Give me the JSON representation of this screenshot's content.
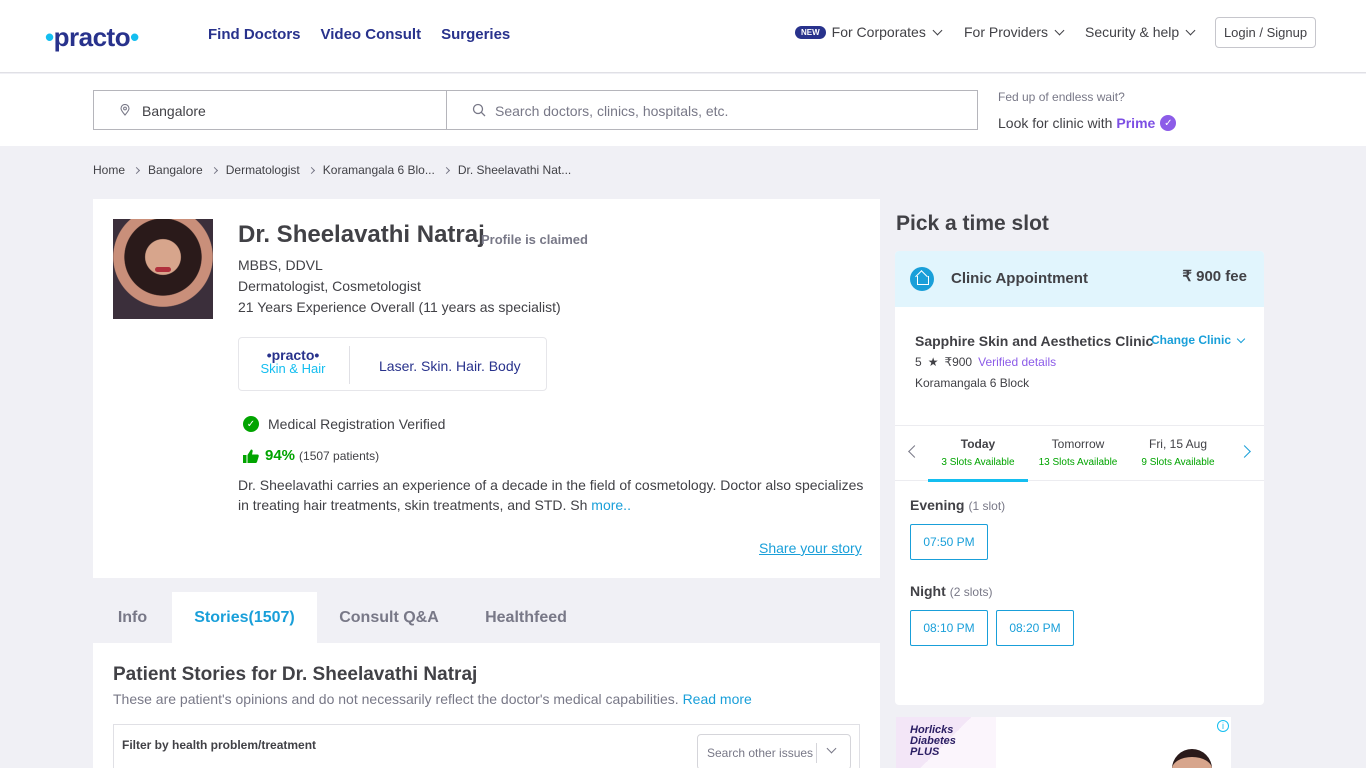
{
  "header": {
    "logo": "practo",
    "nav": [
      "Find Doctors",
      "Video Consult",
      "Surgeries"
    ],
    "new_badge": "NEW",
    "corporates": "For Corporates",
    "providers": "For Providers",
    "security": "Security & help",
    "login": "Login / Signup"
  },
  "search": {
    "location_value": "Bangalore",
    "query_placeholder": "Search doctors, clinics, hospitals, etc.",
    "prime_line1": "Fed up of endless wait?",
    "prime_line2": "Look for clinic with",
    "prime_word": "Prime"
  },
  "breadcrumb": [
    "Home",
    "Bangalore",
    "Dermatologist",
    "Koramangala 6 Blo...",
    "Dr. Sheelavathi Nat..."
  ],
  "profile": {
    "name": "Dr. Sheelavathi Natraj",
    "claimed": "Profile is claimed",
    "degrees": "MBBS, DDVL",
    "specialties": "Dermatologist, Cosmetologist",
    "experience": "21 Years Experience Overall  (11 years as specialist)",
    "partner_logo_top": "•practo•",
    "partner_logo_bottom": "Skin & Hair",
    "partner_tagline": "Laser. Skin. Hair. Body",
    "verified": "Medical Registration Verified",
    "rating_pct": "94%",
    "rating_count": "(1507 patients)",
    "about": "Dr. Sheelavathi carries an experience of a decade in the field of cosmetology. Doctor also specializes in treating hair treatments, skin treatments, and STD. Sh",
    "more": "more..",
    "share": "Share your story"
  },
  "tabs": [
    "Info",
    "Stories(1507)",
    "Consult Q&A",
    "Healthfeed"
  ],
  "stories": {
    "title": "Patient Stories for Dr. Sheelavathi Natraj",
    "subtitle": "These are patient's opinions and do not necessarily reflect the doctor's medical capabilities.",
    "read_more": "Read more",
    "filter_label": "Filter by health problem/treatment",
    "filter_placeholder": "Search other issues"
  },
  "booking": {
    "heading": "Pick a time slot",
    "type": "Clinic Appointment",
    "fee": "₹ 900 fee",
    "clinic_name": "Sapphire Skin and Aesthetics Clinic",
    "change": "Change Clinic",
    "clinic_rating": "5",
    "clinic_fee": "₹900",
    "verified_details": "Verified details",
    "address": "Koramangala 6 Block",
    "days": [
      {
        "name": "Today",
        "slots": "3 Slots Available"
      },
      {
        "name": "Tomorrow",
        "slots": "13 Slots Available"
      },
      {
        "name": "Fri, 15 Aug",
        "slots": "9 Slots Available"
      }
    ],
    "evening_label": "Evening",
    "evening_count": "(1 slot)",
    "evening_slots": [
      "07:50 PM"
    ],
    "night_label": "Night",
    "night_count": "(2 slots)",
    "night_slots": [
      "08:10 PM",
      "08:20 PM"
    ]
  },
  "ad": {
    "brand_line1": "Horlicks",
    "brand_line2": "Diabetes",
    "brand_line3": "PLUS"
  },
  "colors": {
    "brand": "#28328c",
    "accent": "#14bef0",
    "link": "#199fd9",
    "success": "#01a400",
    "prime": "#7d4fe4"
  }
}
